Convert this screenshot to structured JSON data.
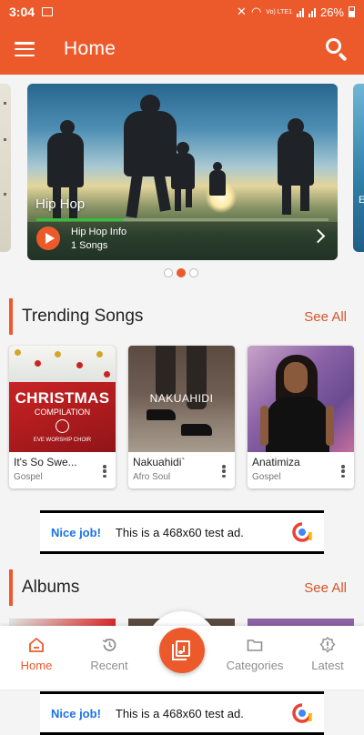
{
  "status_bar": {
    "time": "3:04",
    "network": "Vo) LTE1",
    "battery": "26%"
  },
  "app_bar": {
    "title": "Home"
  },
  "carousel": {
    "featured": {
      "genre": "Hip Hop",
      "name": "Hip Hop Info",
      "count": "1 Songs",
      "progress": 0.3
    },
    "right_peek_letter": "E",
    "page_count": 3,
    "active_page": 2
  },
  "trending": {
    "title": "Trending Songs",
    "see_all": "See All",
    "songs": [
      {
        "title": "It's So Swe...",
        "genre": "Gospel",
        "art_title": "CHRISTMAS",
        "art_subtitle": "COMPILATION",
        "art_credit": "EVE WORSHIP CHOIR"
      },
      {
        "title": "Nakuahidi`",
        "genre": "Afro Soul",
        "art_title": "NAKUAHIDI"
      },
      {
        "title": "Anatimiza",
        "genre": "Gospel"
      }
    ]
  },
  "ad": {
    "nice": "Nice job!",
    "text": "This is a 468x60 test ad."
  },
  "albums": {
    "title": "Albums",
    "see_all": "See All"
  },
  "bottom_nav": {
    "items": [
      {
        "label": "Home",
        "icon": "home-icon",
        "active": true
      },
      {
        "label": "Recent",
        "icon": "history-icon",
        "active": false
      },
      {
        "label": "Categories",
        "icon": "folder-icon",
        "active": false
      },
      {
        "label": "Latest",
        "icon": "new-release-icon",
        "active": false
      }
    ],
    "center_icon": "library-music-icon"
  },
  "colors": {
    "accent": "#ec5a2c",
    "see_all": "#d9542a",
    "progress": "#31c13b",
    "ad_link": "#1a73e8"
  }
}
